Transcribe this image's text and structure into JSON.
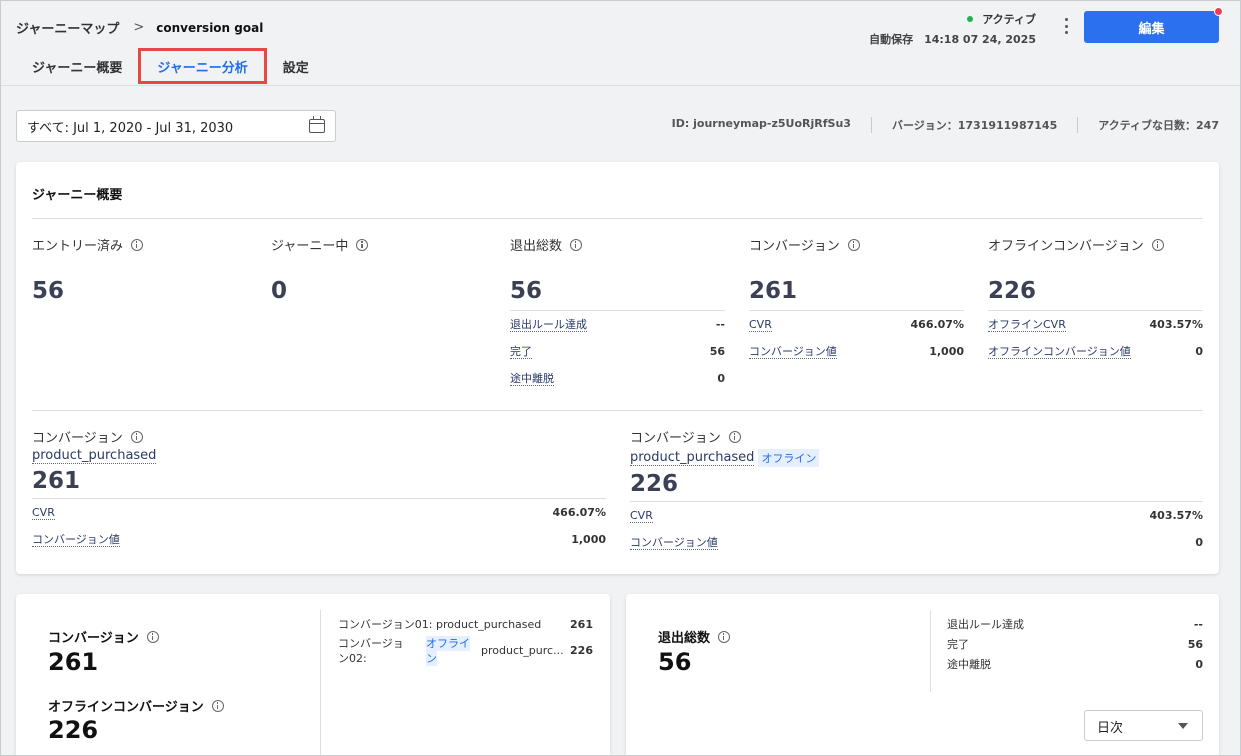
{
  "breadcrumb": {
    "root": "ジャーニーマップ",
    "separator": ">",
    "current": "conversion goal"
  },
  "tabs": [
    {
      "label": "ジャーニー概要"
    },
    {
      "label": "ジャーニー分析"
    },
    {
      "label": "設定"
    }
  ],
  "status": {
    "state": "アクティブ",
    "autosave": "自動保存　14:18 07 24, 2025"
  },
  "edit_button": "編集",
  "date_filter": "すべて: Jul 1, 2020 - Jul 31, 2030",
  "meta": {
    "id": "ID: journeymap-z5UoRjRfSu3",
    "version": "バージョン：1731911987145",
    "active_days": "アクティブな日数：247"
  },
  "overview": {
    "title": "ジャーニー概要",
    "entered": {
      "label": "エントリー済み",
      "value": "56"
    },
    "in_journey": {
      "label": "ジャーニー中",
      "value": "0"
    },
    "exits": {
      "label": "退出総数",
      "value": "56",
      "rows": [
        {
          "k": "退出ルール達成",
          "v": "--"
        },
        {
          "k": "完了",
          "v": "56"
        },
        {
          "k": "途中離脱",
          "v": "0"
        }
      ]
    },
    "conversion": {
      "label": "コンバージョン",
      "value": "261",
      "rows": [
        {
          "k": "CVR",
          "v": "466.07%"
        },
        {
          "k": "コンバージョン値",
          "v": "1,000"
        }
      ]
    },
    "offline": {
      "label": "オフラインコンバージョン",
      "value": "226",
      "rows": [
        {
          "k": "オフラインCVR",
          "v": "403.57%"
        },
        {
          "k": "オフラインコンバージョン値",
          "v": "0"
        }
      ]
    },
    "conv_online": {
      "label": "コンバージョン",
      "name": "product_purchased",
      "value": "261",
      "rows": [
        {
          "k": "CVR",
          "v": "466.07%"
        },
        {
          "k": "コンバージョン値",
          "v": "1,000"
        }
      ]
    },
    "conv_offline": {
      "label": "コンバージョン",
      "name": "product_purchased",
      "tag": "オフライン",
      "value": "226",
      "rows": [
        {
          "k": "CVR",
          "v": "403.57%"
        },
        {
          "k": "コンバージョン値",
          "v": "0"
        }
      ]
    }
  },
  "bottom_left": {
    "conv_label": "コンバージョン",
    "conv_value": "261",
    "offline_label": "オフラインコンバージョン",
    "offline_value": "226",
    "list": {
      "r1_k": "コンバージョン01: product_purchased",
      "r1_v": "261",
      "r2_k_a": "コンバージョ",
      "r2_k_b": "ン02:",
      "r2_tag_a": "オフライ",
      "r2_tag_b": "ン",
      "r2_name": "product_purc...",
      "r2_v": "226"
    }
  },
  "bottom_right": {
    "label": "退出総数",
    "value": "56",
    "rows": [
      {
        "k": "退出ルール達成",
        "v": "--"
      },
      {
        "k": "完了",
        "v": "56"
      },
      {
        "k": "途中離脱",
        "v": "0"
      }
    ],
    "select": "日次"
  }
}
